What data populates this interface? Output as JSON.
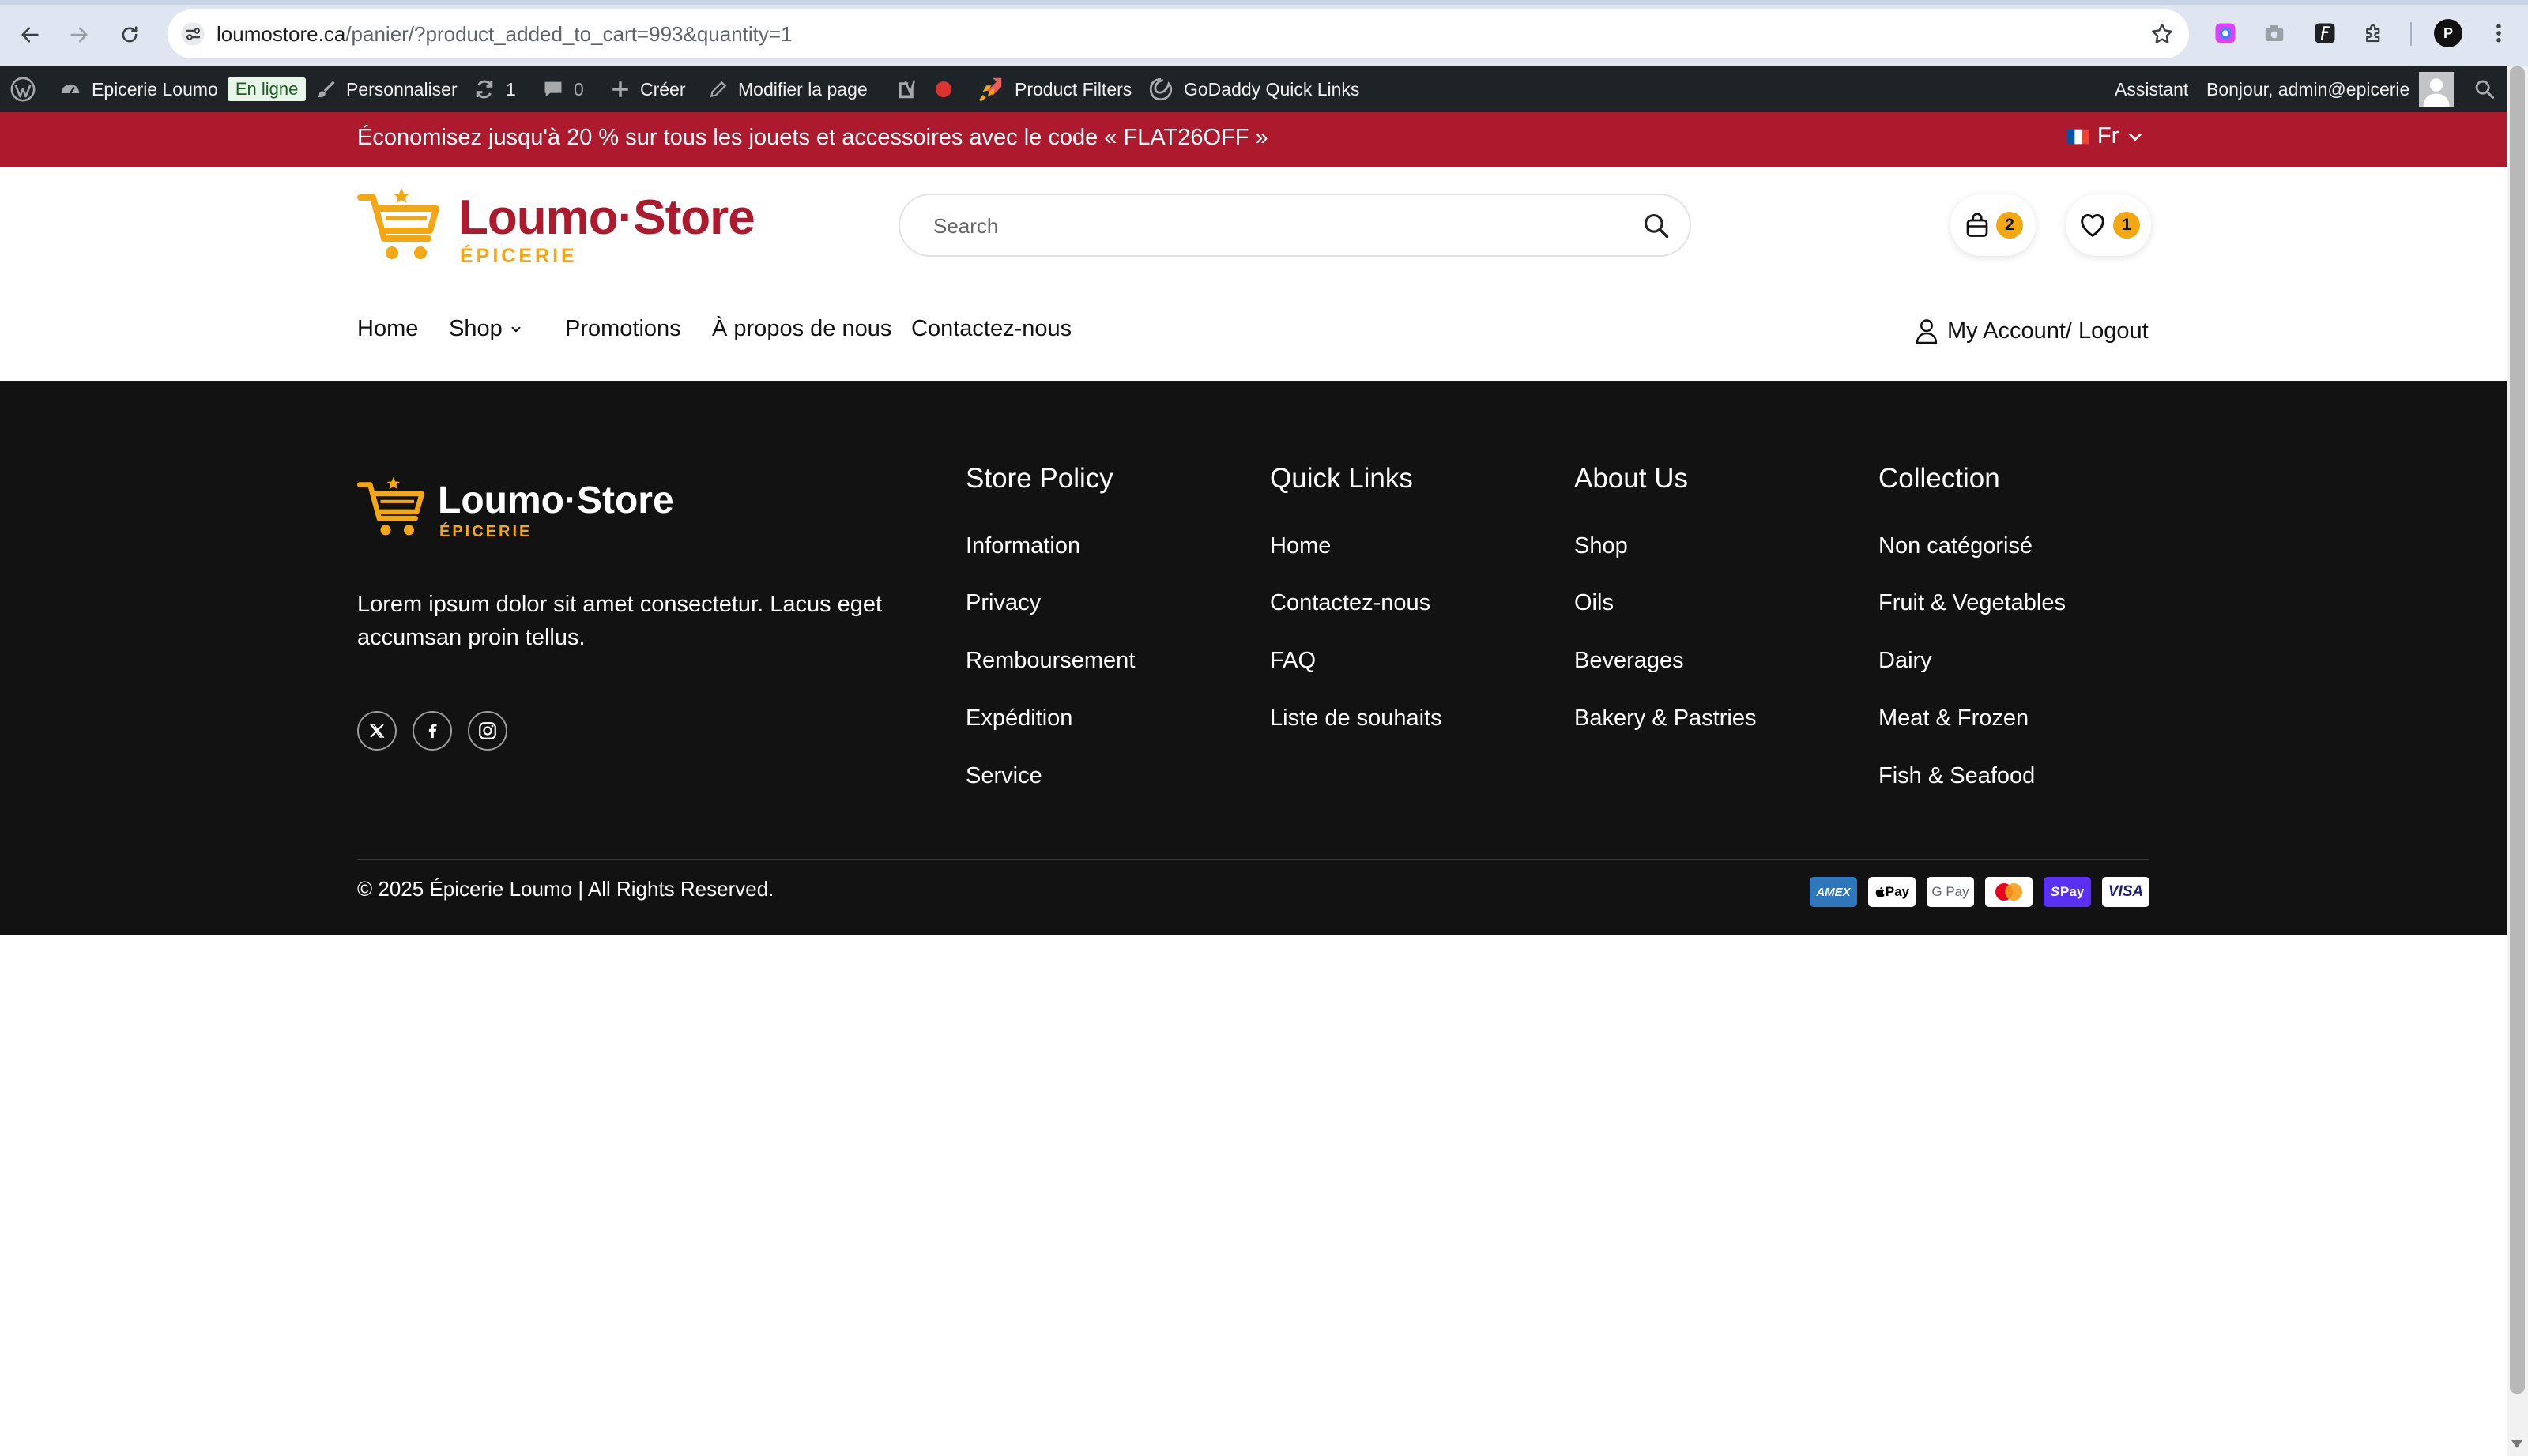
{
  "browser": {
    "url_host": "loumostore.ca",
    "url_path": "/panier/?product_added_to_cart=993&quantity=1",
    "profile_initial": "P"
  },
  "adminbar": {
    "site_name": "Epicerie Loumo",
    "status_badge": "En ligne",
    "customize": "Personnaliser",
    "updates_count": "1",
    "comments_count": "0",
    "create": "Créer",
    "edit_page": "Modifier la page",
    "product_filters": "Product Filters",
    "godaddy": "GoDaddy Quick Links",
    "assistant": "Assistant",
    "greeting": "Bonjour, admin@epicerie"
  },
  "promo": {
    "text": "Économisez jusqu'à 20 % sur tous les jouets et accessoires avec le code « FLAT26OFF »",
    "language": "Fr"
  },
  "brand": {
    "name": "Loumo·Store",
    "tagline": "ÉPICERIE",
    "primary_color": "#ad1a2d",
    "accent_color": "#f3a712"
  },
  "header": {
    "search_placeholder": "Search",
    "cart_count": "2",
    "wishlist_count": "1",
    "menu": {
      "home": "Home",
      "shop": "Shop",
      "promotions": "Promotions",
      "about": "À propos de nous",
      "contact": "Contactez-nous"
    },
    "account": "My Account/ Logout"
  },
  "footer": {
    "description": "Lorem ipsum dolor sit amet consectetur. Lacus eget accumsan proin tellus.",
    "columns": [
      {
        "title": "Store Policy",
        "links": [
          "Information",
          "Privacy",
          "Remboursement",
          "Expédition",
          "Service"
        ]
      },
      {
        "title": "Quick Links",
        "links": [
          "Home",
          "Contactez-nous",
          "FAQ",
          "Liste de souhaits"
        ]
      },
      {
        "title": "About Us",
        "links": [
          "Shop",
          "Oils",
          "Beverages",
          "Bakery & Pastries"
        ]
      },
      {
        "title": "Collection",
        "links": [
          "Non catégorisé",
          "Fruit & Vegetables",
          "Dairy",
          "Meat & Frozen",
          "Fish & Seafood"
        ]
      }
    ],
    "copyright": "© 2025 Épicerie Loumo | All Rights Reserved.",
    "payments": {
      "amex": "AMEX",
      "apple_pay": " Pay",
      "google_pay": "G Pay",
      "shop_pay": "Pay",
      "visa": "VISA"
    }
  }
}
